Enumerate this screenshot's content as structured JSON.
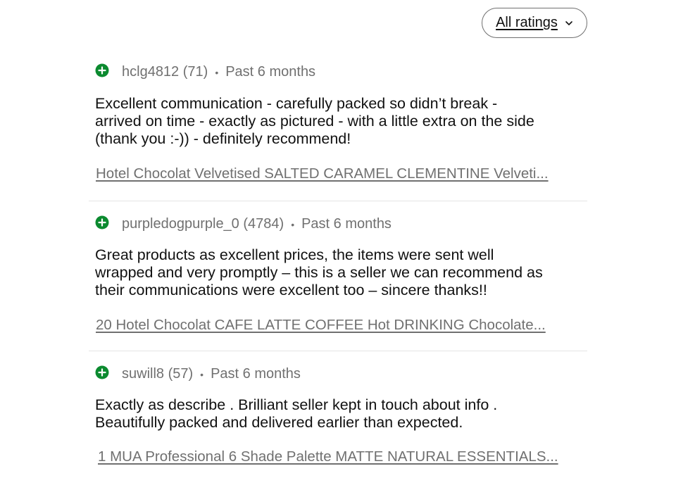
{
  "filter": {
    "label": "All ratings",
    "icon": "chevron-down-icon"
  },
  "colors": {
    "positive": "#0b8a2f",
    "text": "#111111",
    "muted": "#707070"
  },
  "reviews": [
    {
      "rating_icon": "positive-plus-icon",
      "user": "hclg4812 (71)",
      "separator": "•",
      "time": "Past 6 months",
      "comment": "Excellent communication - carefully packed so didn’t break - arrived on time - exactly as pictured -  with a little extra on the side (thank you :-)) - definitely recommend!",
      "item": "Hotel Chocolat Velvetised SALTED CARAMEL CLEMENTINE Velveti..."
    },
    {
      "rating_icon": "positive-plus-icon",
      "user": "purpledogpurple_0 (4784)",
      "separator": "•",
      "time": "Past 6 months",
      "comment": "Great products as excellent prices, the items were sent well wrapped and very promptly – this is a seller we can recommend as their communications were excellent too – sincere thanks!!",
      "item": "20 Hotel Chocolat CAFE LATTE COFFEE Hot DRINKING Chocolate..."
    },
    {
      "rating_icon": "positive-plus-icon",
      "user": "suwill8 (57)",
      "separator": "•",
      "time": "Past 6 months",
      "comment": "Exactly as describe . Brilliant seller kept in touch about info . Beautifully packed and delivered earlier than expected.",
      "item": "1 MUA Professional 6 Shade Palette MATTE NATURAL ESSENTIALS..."
    }
  ]
}
